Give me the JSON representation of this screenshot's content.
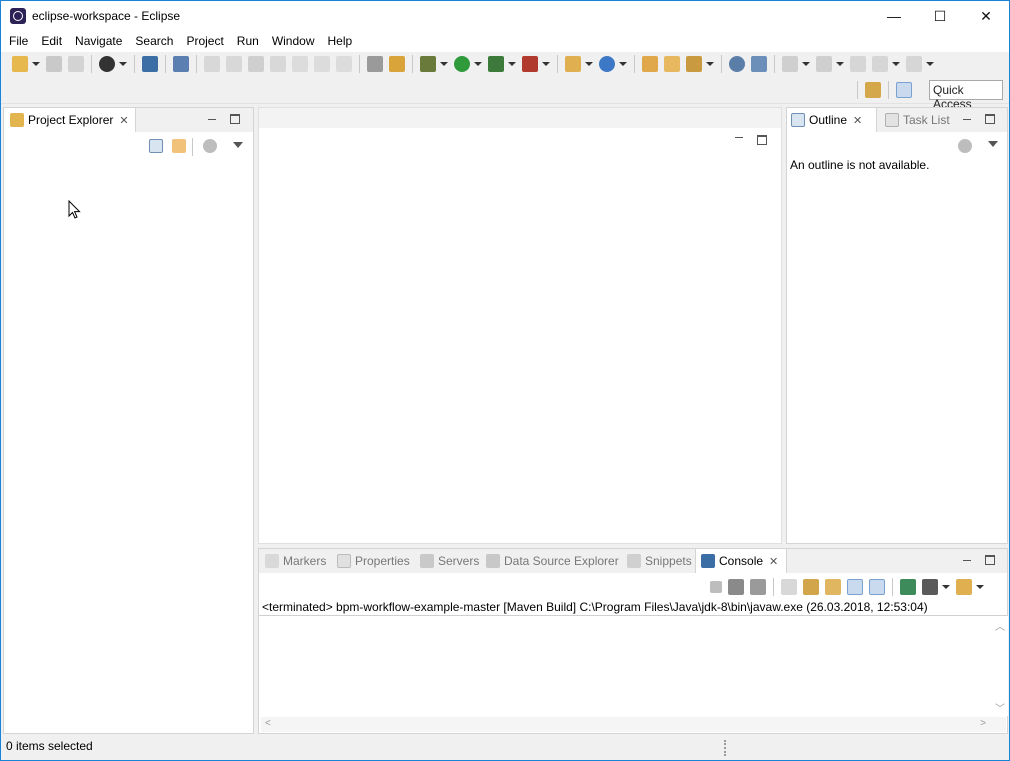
{
  "window": {
    "title": "eclipse-workspace - Eclipse",
    "minimize": "—",
    "maximize": "☐",
    "close": "✕"
  },
  "menu": [
    "File",
    "Edit",
    "Navigate",
    "Search",
    "Project",
    "Run",
    "Window",
    "Help"
  ],
  "toolbar": {
    "quick_access": "Quick Access"
  },
  "project_explorer": {
    "tab_label": "Project Explorer"
  },
  "outline": {
    "tab_label": "Outline",
    "task_list_label": "Task List",
    "message": "An outline is not available."
  },
  "bottom_panel": {
    "tabs": [
      "Markers",
      "Properties",
      "Servers",
      "Data Source Explorer",
      "Snippets"
    ],
    "active_tab": "Console",
    "console_text": "<terminated> bpm-workflow-example-master [Maven Build] C:\\Program Files\\Java\\jdk-8\\bin\\javaw.exe (26.03.2018, 12:53:04)"
  },
  "status": {
    "text": "0 items selected"
  },
  "colors": {
    "accent": "#1883d7",
    "active_tab_bg": "#ffffff",
    "chrome_bg": "#f0f0f0"
  }
}
